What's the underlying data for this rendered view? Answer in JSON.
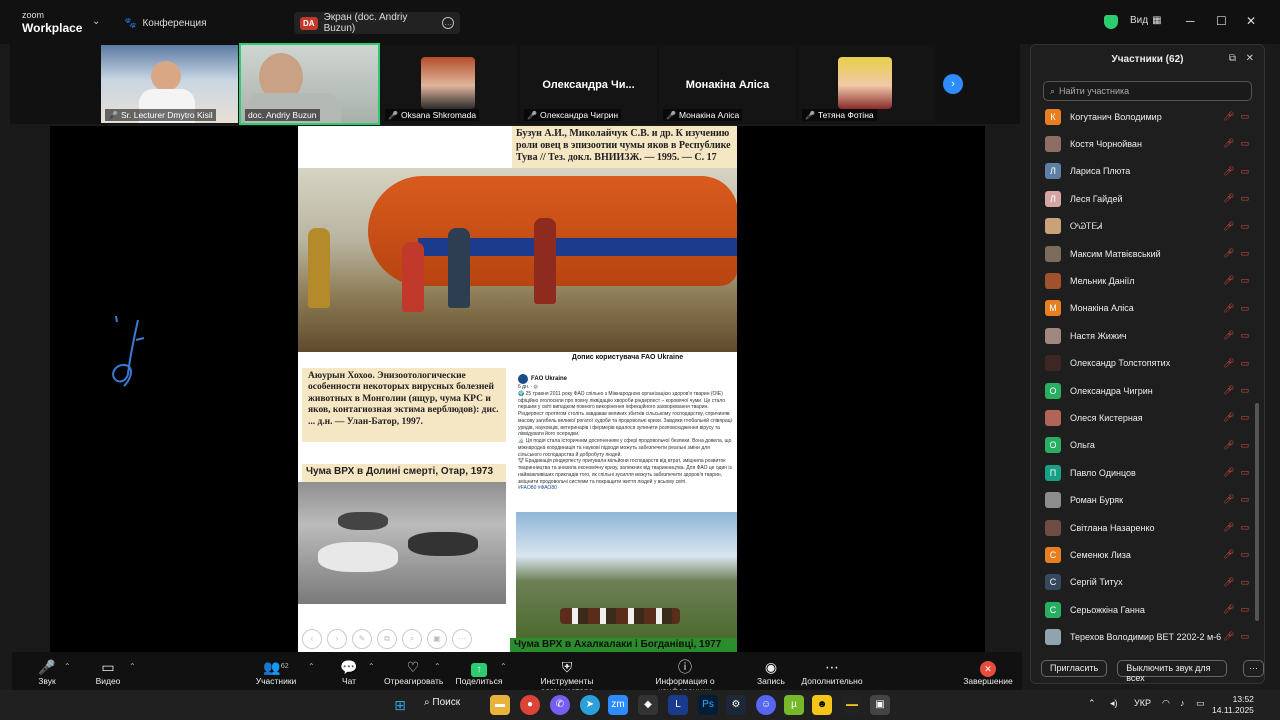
{
  "app": {
    "logo_top": "zoom",
    "logo_bottom": "Workplace"
  },
  "tabs": {
    "conference": "Конференция",
    "screen_badge": "DA",
    "screen": "Экран (doc. Andriy Buzun)"
  },
  "window": {
    "view_label": "Вид",
    "minimize": "─",
    "maximize": "☐",
    "close": "✕"
  },
  "videos": [
    {
      "name": "Sr. Lecturer Dmytro Kisil",
      "muted": true
    },
    {
      "name": "doc. Andriy Buzun",
      "muted": false,
      "active": true
    },
    {
      "name": "Oksana Shkromada",
      "muted": true
    },
    {
      "name": "Олександра Чигрин",
      "display": "Олександра  Чи...",
      "muted": true
    },
    {
      "name": "Монакіна Аліса",
      "display": "Монакіна Аліса",
      "muted": true
    },
    {
      "name": "Тетяна Фотіна",
      "muted": true
    }
  ],
  "document": {
    "ref_top": "Бузун А.И., Миколайчук С.В. и др. К изучению роли овец в эпизоотии чумы яков в Республике Тува // Тез. докл. ВНИИЗЖ. — 1995. — С. 17",
    "photo_caption": "Допис користувача FAO Ukraine",
    "ref_box": "Аюурын Хохоо. Энизоотологические особенности некоторых вирусных болезней животных в Монголии (ящур, чума КРС и яков, контагиозная эктима верблюдов): дис. ... д.н. — Улан-Батор, 1997.",
    "chuma_label": "Чума ВРХ в Долині смерті, Отар, 1973",
    "fao_name": "FAO Ukraine",
    "fao_time": "6 дн. · ◎",
    "fao_p1": "🌍 25 травня 2011 року ФАО спільно з Міжнародною організацією здоров'я тварин (ОІЕ) офіційно оголосили про повну ліквідацію хвороби ріндерпест – коровячої чуми. Це стало першим у світі випадком повного викорінення інфекційного захворювання тварин.",
    "fao_p2": "Ріндерпест протягом століть завдавав великих збитків сільському господарству, спричиняв масову загибель великої рогатої худоби та продовольчі кризи. Завдяки глобальній співпраці урядів, науковців, ветеринарів і фермерів вдалося зупинити розповсюдження вірусу та ліквідувати його осередки.",
    "fao_p3": "🔬 Ця подія стала історичним досягненням у сфері продовольчої безпеки. Вона довела, що міжнародна координація та наукові підходи можуть забезпечити реальні зміни для сільського господарства й добробуту людей.",
    "fao_p4": "🐮 Ерадикація ріндерпесту пригувала мільйони господарств від втрат, зміцнила розвиток тваринництва та знизила економічну кризу, залежних від тваринництва. Для ФАО це один із найважливіших прикладів того, як спільні зусилля можуть забезпечити здоров'я тварин, зміцнити продовольчі системи та покращити життя людей у всьому світі.",
    "fao_tags": "#FAO80 #ФАО80",
    "chuma_bottom": "Чума ВРХ в Ахалкалаки і Богданівці, 1977"
  },
  "participants_panel": {
    "title": "Участники (62)",
    "search_placeholder": "Найти участника",
    "invite": "Пригласить",
    "mute_all": "Выключить звук для всех",
    "more": "···",
    "items": [
      {
        "name": "Когутанич Володимир",
        "initial": "К",
        "color": "#e67e22"
      },
      {
        "name": "Костя Чорнойван",
        "initial": "",
        "color": "#8d6e63"
      },
      {
        "name": "Лариса Плюта",
        "initial": "Л",
        "color": "#5d7fa3"
      },
      {
        "name": "Леся Гайдей",
        "initial": "Л",
        "color": "#d4a5a5"
      },
      {
        "name": "ᎤᏊᎢᎬᏗ",
        "initial": "",
        "color": "#c9a27a"
      },
      {
        "name": "Максим Матвієвський",
        "initial": "",
        "color": "#7a6b5b"
      },
      {
        "name": "Мельник Даніїл",
        "initial": "",
        "color": "#a0522d"
      },
      {
        "name": "Монакіна Аліса",
        "initial": "М",
        "color": "#e67e22"
      },
      {
        "name": "Настя Жижич",
        "initial": "",
        "color": "#a1887f"
      },
      {
        "name": "Олександр Толстопятих",
        "initial": "",
        "color": "#3e2723"
      },
      {
        "name": "Олександра Чигрин",
        "initial": "О",
        "color": "#27ae60"
      },
      {
        "name": "Олеся Кистерная",
        "initial": "",
        "color": "#b0645a"
      },
      {
        "name": "Ольга",
        "initial": "О",
        "color": "#27ae60"
      },
      {
        "name": "Павло Одинцов",
        "initial": "П",
        "color": "#16a085"
      },
      {
        "name": "Роман Буряк",
        "initial": "",
        "color": "#8d8d8d"
      },
      {
        "name": "Світлана Назаренко",
        "initial": "",
        "color": "#6d4c41"
      },
      {
        "name": "Семенюк Лиза",
        "initial": "С",
        "color": "#e67e22"
      },
      {
        "name": "Сергій Титух",
        "initial": "С",
        "color": "#34495e"
      },
      {
        "name": "Серьожкіна Ганна",
        "initial": "С",
        "color": "#27ae60"
      },
      {
        "name": "Терехов Володимир ВЕТ 2202-2 м-6",
        "initial": "",
        "color": "#90a4ae"
      }
    ]
  },
  "toolbar": {
    "sound": "Звук",
    "video": "Видео",
    "participants": "Участники",
    "participants_count": "62",
    "chat": "Чат",
    "react": "Отреагировать",
    "share": "Поделиться",
    "host_tools": "Инструменты организатора",
    "info": "Информация о конференции",
    "record": "Запись",
    "more": "Дополнительно",
    "end": "Завершение"
  },
  "taskbar": {
    "search": "Поиск",
    "lang": "УКР",
    "time": "13:52",
    "date": "14.11.2025"
  }
}
